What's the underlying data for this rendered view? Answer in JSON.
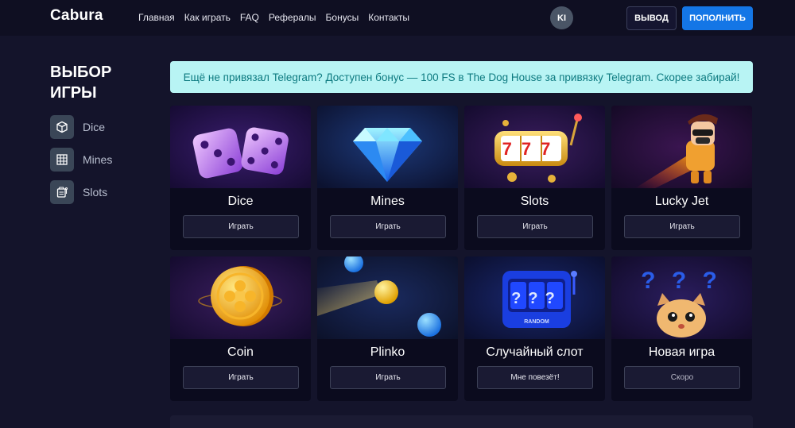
{
  "header": {
    "logo": "Cabura",
    "nav": [
      "Главная",
      "Как играть",
      "FAQ",
      "Рефералы",
      "Бонусы",
      "Контакты"
    ],
    "avatar_initials": "KI",
    "withdraw_label": "ВЫВОД",
    "deposit_label": "ПОПОЛНИТЬ"
  },
  "sidebar": {
    "title": "ВЫБОР ИГРЫ",
    "items": [
      {
        "label": "Dice",
        "icon": "cube-icon"
      },
      {
        "label": "Mines",
        "icon": "grid-icon"
      },
      {
        "label": "Slots",
        "icon": "slot-machine-icon"
      }
    ]
  },
  "banner": {
    "text": "Ещё не привязал Telegram? Доступен бонус — 100 FS в The Dog House за привязку Telegram. Скорее забирай!"
  },
  "games": [
    {
      "title": "Dice",
      "button": "Играть"
    },
    {
      "title": "Mines",
      "button": "Играть"
    },
    {
      "title": "Slots",
      "button": "Играть"
    },
    {
      "title": "Lucky Jet",
      "button": "Играть"
    },
    {
      "title": "Coin",
      "button": "Играть"
    },
    {
      "title": "Plinko",
      "button": "Играть"
    },
    {
      "title": "Случайный слот",
      "button": "Мне повезёт!"
    },
    {
      "title": "Новая игра",
      "button": "Скоро"
    }
  ],
  "art": {
    "slots_reels": "777",
    "random_reels": "???",
    "random_label": "RANDOM",
    "question_marks": "? ? ?"
  },
  "colors": {
    "background": "#14142b",
    "header": "#0f0f22",
    "accent_blue": "#1476e6",
    "banner_bg": "#b8f4f4",
    "banner_text": "#0d7a80"
  }
}
